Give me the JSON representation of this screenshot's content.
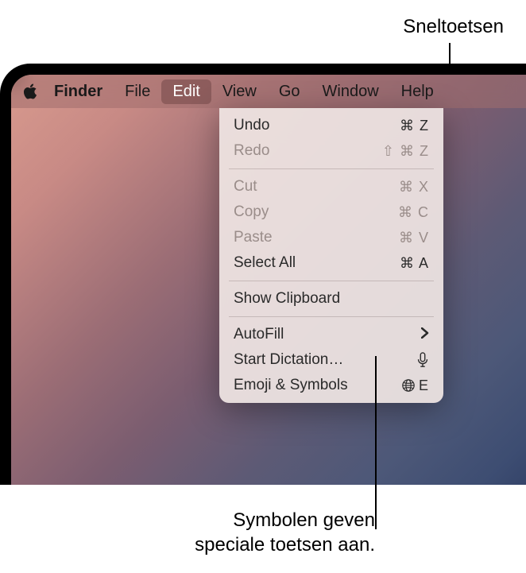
{
  "callouts": {
    "top": "Sneltoetsen",
    "bottom_line1": "Symbolen geven",
    "bottom_line2": "speciale toetsen aan."
  },
  "menubar": {
    "app": "Finder",
    "items": [
      "File",
      "Edit",
      "View",
      "Go",
      "Window",
      "Help"
    ]
  },
  "dropdown": {
    "undo": {
      "label": "Undo",
      "shortcut": "⌘ Z"
    },
    "redo": {
      "label": "Redo",
      "shortcut": "⇧ ⌘ Z"
    },
    "cut": {
      "label": "Cut",
      "shortcut": "⌘ X"
    },
    "copy": {
      "label": "Copy",
      "shortcut": "⌘ C"
    },
    "paste": {
      "label": "Paste",
      "shortcut": "⌘ V"
    },
    "selectall": {
      "label": "Select All",
      "shortcut": "⌘ A"
    },
    "clipboard": {
      "label": "Show Clipboard"
    },
    "autofill": {
      "label": "AutoFill"
    },
    "dictation": {
      "label": "Start Dictation…"
    },
    "emoji": {
      "label": "Emoji & Symbols",
      "shortcut": "E"
    }
  }
}
